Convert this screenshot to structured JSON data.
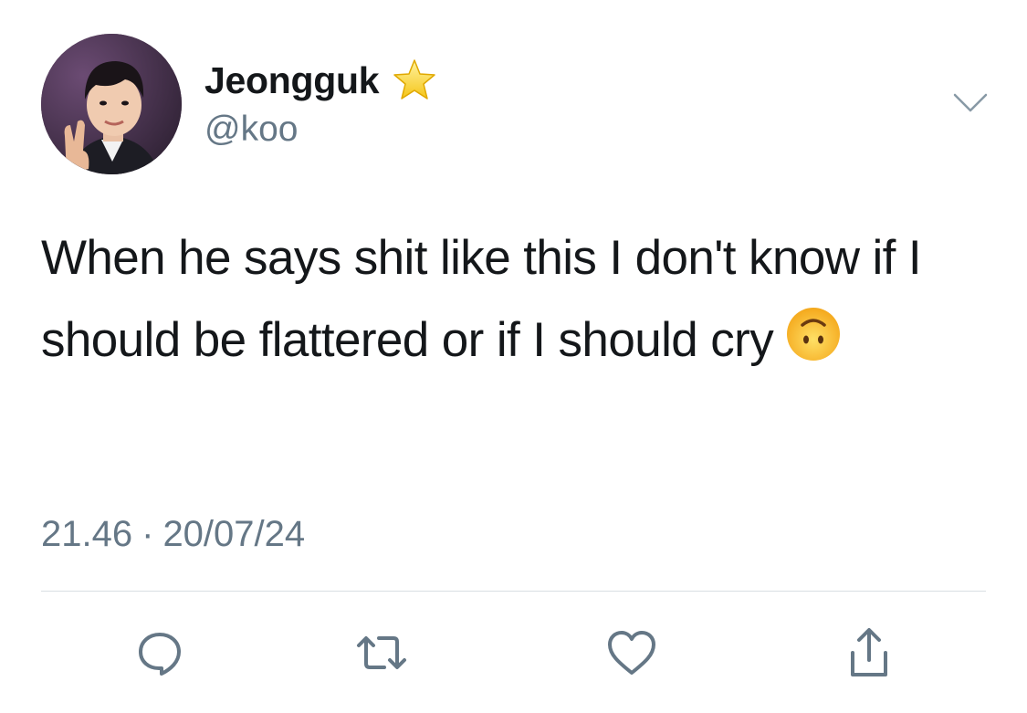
{
  "author": {
    "display_name": "Jeongguk",
    "handle": "@koo",
    "badge_icon": "star-icon",
    "avatar_icon": "profile-photo"
  },
  "tweet": {
    "text": "When he says shit like this I don't know if I should be flattered or if I should cry",
    "emoji_icon": "upside-down-face-emoji",
    "time": "21.46",
    "separator": "·",
    "date": "20/07/24"
  },
  "actions": [
    {
      "icon": "reply-icon"
    },
    {
      "icon": "retweet-icon"
    },
    {
      "icon": "like-icon"
    },
    {
      "icon": "share-icon"
    }
  ],
  "colors": {
    "text": "#14171a",
    "secondary": "#657786",
    "icon": "#657786",
    "divider": "#d9dee3",
    "star": "#f5c518"
  }
}
